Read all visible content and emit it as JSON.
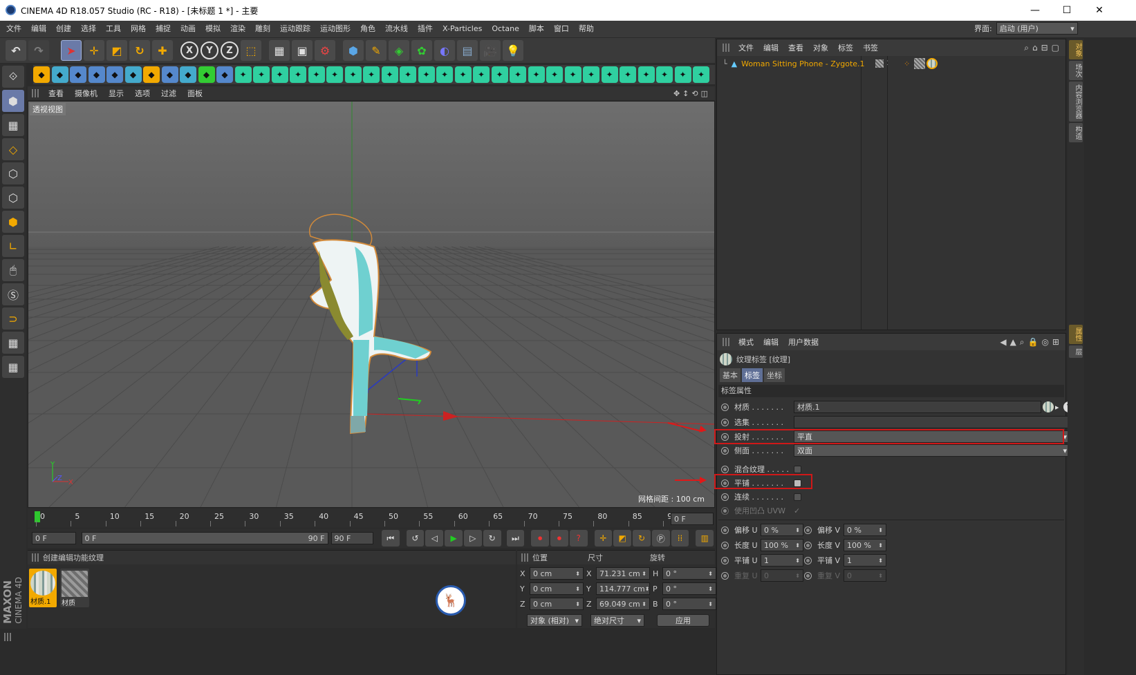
{
  "window": {
    "title": "CINEMA 4D R18.057 Studio (RC - R18) - [未标题 1 *] - 主要",
    "minimize": "—",
    "maximize": "☐",
    "close": "✕"
  },
  "menu": [
    "文件",
    "编辑",
    "创建",
    "选择",
    "工具",
    "网格",
    "捕捉",
    "动画",
    "模拟",
    "渲染",
    "雕刻",
    "运动跟踪",
    "运动图形",
    "角色",
    "流水线",
    "插件",
    "X-Particles",
    "Octane",
    "脚本",
    "窗口",
    "帮助"
  ],
  "layout": {
    "label": "界面:",
    "value": "启动 (用户)"
  },
  "viewport": {
    "menu": [
      "查看",
      "摄像机",
      "显示",
      "选项",
      "过滤",
      "面板"
    ],
    "label": "透视视图",
    "grid_spacing": "网格间距 : 100 cm",
    "axis_y": "Y",
    "axis_z": "Z",
    "axis_x": "X"
  },
  "timeline": {
    "ticks": [
      "0",
      "5",
      "10",
      "15",
      "20",
      "25",
      "30",
      "35",
      "40",
      "45",
      "50",
      "55",
      "60",
      "65",
      "70",
      "75",
      "80",
      "85",
      "90"
    ],
    "current_frame": "0 F",
    "start": "0 F",
    "range_start": "0 F",
    "range_end": "90 F",
    "end": "90 F"
  },
  "materials": {
    "menu": [
      "创建",
      "编辑",
      "功能",
      "纹理"
    ],
    "items": [
      {
        "label": "材质.1"
      },
      {
        "label": "材质"
      }
    ]
  },
  "coords": {
    "headers": {
      "pos": "位置",
      "size": "尺寸",
      "rot": "旋转"
    },
    "rows": [
      {
        "axis": "X",
        "pos": "0 cm",
        "saxis": "X",
        "size": "71.231 cm",
        "raxis": "H",
        "rot": "0 °"
      },
      {
        "axis": "Y",
        "pos": "0 cm",
        "saxis": "Y",
        "size": "114.777 cm",
        "raxis": "P",
        "rot": "0 °"
      },
      {
        "axis": "Z",
        "pos": "0 cm",
        "saxis": "Z",
        "size": "69.049 cm",
        "raxis": "B",
        "rot": "0 °"
      }
    ],
    "mode": "对象 (相对)",
    "size_mode": "绝对尺寸",
    "apply": "应用"
  },
  "objects": {
    "menu": [
      "文件",
      "编辑",
      "查看",
      "对象",
      "标签",
      "书签"
    ],
    "item": "Woman Sitting Phone - Zygote.1"
  },
  "attributes": {
    "menu": [
      "模式",
      "编辑",
      "用户数据"
    ],
    "title": "纹理标签 [纹理]",
    "tabs": [
      "基本",
      "标签",
      "坐标"
    ],
    "section": "标签属性",
    "material_label": "材质 . . . . . . .",
    "material_value": "材质.1",
    "selection_label": "选集 . . . . . . .",
    "projection_label": "投射 . . . . . . .",
    "projection_value": "平直",
    "side_label": "侧面 . . . . . . .",
    "side_value": "双面",
    "mix_label": "混合纹理 . . . . .",
    "tile_label": "平铺 . . . . . . .",
    "seamless_label": "连续 . . . . . . .",
    "bump_label": "使用凹凸 UVW",
    "bump_check": "✓",
    "offset_u": "偏移 U",
    "offset_u_val": "0 %",
    "offset_v": "偏移 V",
    "offset_v_val": "0 %",
    "length_u": "长度 U",
    "length_u_val": "100 %",
    "length_v": "长度 V",
    "length_v_val": "100 %",
    "tiles_u": "平铺 U",
    "tiles_u_val": "1",
    "tiles_v": "平铺 V",
    "tiles_v_val": "1",
    "repeat_u": "重复 U",
    "repeat_u_val": "0",
    "repeat_v": "重复 V",
    "repeat_v_val": "0"
  },
  "right_tabs": [
    "对象",
    "场次",
    "内容浏览器",
    "构造",
    "属性",
    "层"
  ],
  "brand": {
    "maxon": "MAXON",
    "c4d": "CINEMA 4D"
  },
  "colors": {
    "accent": "#f2a900",
    "highlight_red": "#d01818",
    "selected_tab": "#5f6f96"
  }
}
